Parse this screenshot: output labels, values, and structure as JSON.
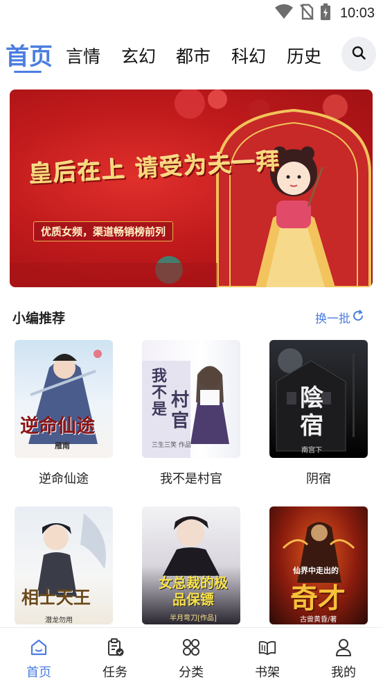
{
  "status_bar": {
    "time": "10:03",
    "icons": [
      "wifi-icon",
      "no-sim-icon",
      "battery-charging-icon"
    ]
  },
  "tabs": [
    {
      "label": "首页",
      "active": true
    },
    {
      "label": "言情",
      "active": false
    },
    {
      "label": "玄幻",
      "active": false
    },
    {
      "label": "都市",
      "active": false
    },
    {
      "label": "科幻",
      "active": false
    },
    {
      "label": "历史",
      "active": false
    }
  ],
  "search": {
    "icon": "search-icon"
  },
  "banner": {
    "title": "皇后在上 请受为夫一拜",
    "subtitle": "优质女频，渠道畅销榜前列"
  },
  "recommend": {
    "title": "小编推荐",
    "refresh_label": "换一批"
  },
  "books": [
    {
      "title": "逆命仙途",
      "cover_text": "逆命仙途",
      "cover_author": "雁南"
    },
    {
      "title": "我不是村官",
      "cover_text": "我不是村官",
      "cover_author": "三生三笑 作品"
    },
    {
      "title": "阴宿",
      "cover_text": "陰宿",
      "cover_author": "南宫下"
    },
    {
      "title": "",
      "cover_text": "相士天王",
      "cover_author": "潜龙勿用"
    },
    {
      "title": "",
      "cover_text": "女总裁的极品保镖",
      "cover_author": "半月弯刀[作品]"
    },
    {
      "title": "",
      "cover_text": "奇才",
      "cover_tagline": "仙界中走出的",
      "cover_author": "古兽黄昏/著"
    }
  ],
  "bottom_nav": [
    {
      "label": "首页",
      "icon": "home-icon",
      "active": true
    },
    {
      "label": "任务",
      "icon": "task-clipboard-icon",
      "active": false
    },
    {
      "label": "分类",
      "icon": "category-grid-icon",
      "active": false
    },
    {
      "label": "书架",
      "icon": "bookshelf-icon",
      "active": false
    },
    {
      "label": "我的",
      "icon": "profile-icon",
      "active": false
    }
  ],
  "colors": {
    "accent": "#4a7de0",
    "banner_red": "#c01a1c",
    "banner_gold": "#f7d77a"
  }
}
